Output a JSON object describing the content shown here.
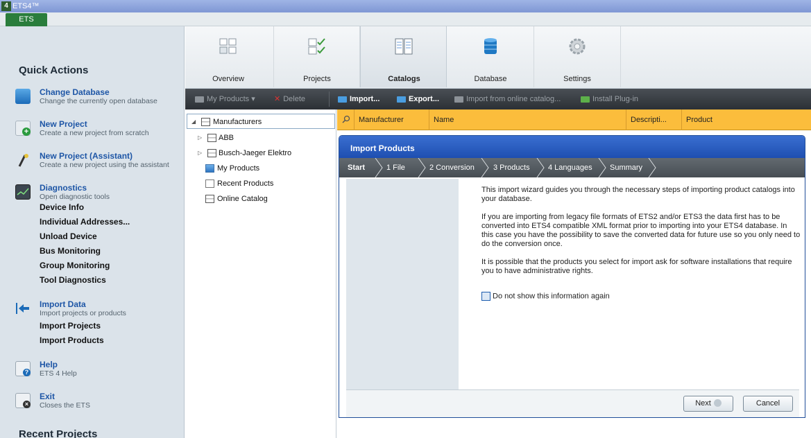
{
  "window": {
    "title": "ETS4™"
  },
  "ribbon": {
    "tab_label": "ETS"
  },
  "quick_actions": {
    "heading": "Quick Actions",
    "change_database": {
      "title": "Change Database",
      "sub": "Change the currently open database"
    },
    "new_project": {
      "title": "New Project",
      "sub": "Create a new project from scratch"
    },
    "new_project_assistant": {
      "title": "New Project (Assistant)",
      "sub": "Create a new project using the assistant"
    },
    "diagnostics": {
      "title": "Diagnostics",
      "sub": "Open diagnostic tools",
      "links": [
        "Device Info",
        "Individual Addresses...",
        "Unload Device",
        "Bus Monitoring",
        "Group Monitoring",
        "Tool Diagnostics"
      ]
    },
    "import_data": {
      "title": "Import Data",
      "sub": "Import projects or products",
      "links": [
        "Import Projects",
        "Import Products"
      ]
    },
    "help": {
      "title": "Help",
      "sub": "ETS 4 Help"
    },
    "exit": {
      "title": "Exit",
      "sub": "Closes the ETS"
    },
    "recent_heading": "Recent Projects"
  },
  "main_toolbar": {
    "buttons": [
      "Overview",
      "Projects",
      "Catalogs",
      "Database",
      "Settings"
    ],
    "active": "Catalogs"
  },
  "catalog_toolbar": {
    "my_products": "My Products",
    "delete": "Delete",
    "import": "Import...",
    "export": "Export...",
    "import_online": "Import from online catalog...",
    "install_plugin": "Install Plug-in"
  },
  "tree": {
    "items": [
      "Manufacturers",
      "ABB",
      "Busch-Jaeger Elektro",
      "My Products",
      "Recent Products",
      "Online Catalog"
    ]
  },
  "grid": {
    "columns": [
      "Manufacturer",
      "Name",
      "Descripti...",
      "Product"
    ]
  },
  "dialog": {
    "title": "Import Products",
    "steps": [
      "Start",
      "1 File",
      "2 Conversion",
      "3 Products",
      "4 Languages",
      "Summary"
    ],
    "paragraphs": [
      "This import wizard guides you through the necessary steps of importing product catalogs into your database.",
      "If you are importing from legacy file formats of ETS2 and/or ETS3 the data first has to be converted into ETS4 compatible XML format prior to importing into your ETS4 database. In this case you have the possibility to save the converted data for future use so you only need to do the conversion once.",
      "It is possible that the products you select for import ask for software installations that require you to have administrative rights."
    ],
    "checkbox_label": "Do not show this information again",
    "next_label": "Next",
    "cancel_label": "Cancel"
  },
  "colors": {
    "accent_green": "#2a7d3c",
    "dialog_blue": "#1e4fb1",
    "grid_header": "#fbbd3c",
    "link_blue": "#1e56a6"
  }
}
